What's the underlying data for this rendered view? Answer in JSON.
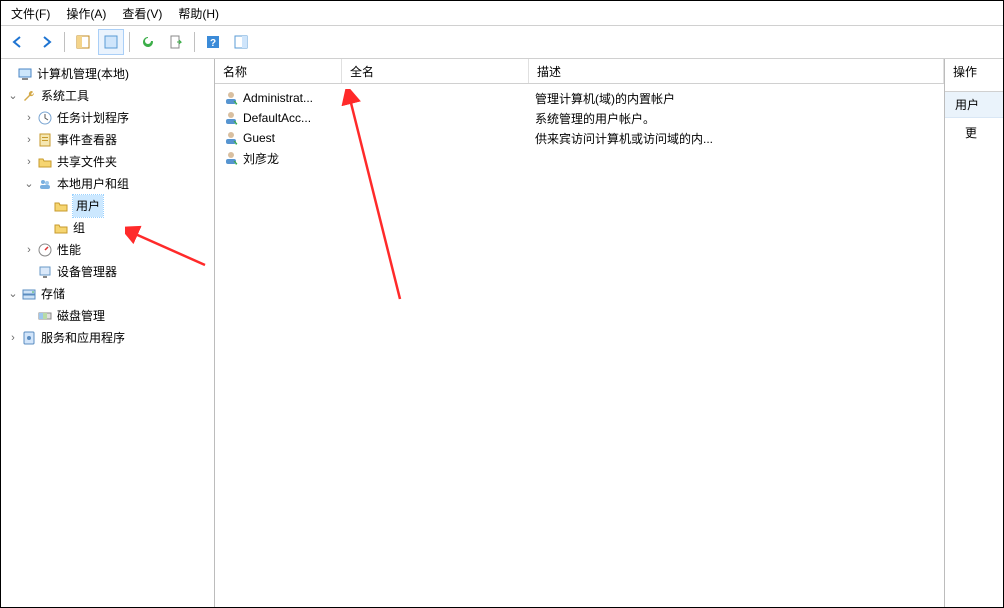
{
  "menu": {
    "file": "文件(F)",
    "action": "操作(A)",
    "view": "查看(V)",
    "help": "帮助(H)"
  },
  "tree": {
    "root": "计算机管理(本地)",
    "system_tools": "系统工具",
    "task_scheduler": "任务计划程序",
    "event_viewer": "事件查看器",
    "shared_folders": "共享文件夹",
    "local_users_groups": "本地用户和组",
    "users": "用户",
    "groups": "组",
    "performance": "性能",
    "device_manager": "设备管理器",
    "storage": "存储",
    "disk_management": "磁盘管理",
    "services_apps": "服务和应用程序"
  },
  "columns": {
    "name": "名称",
    "fullname": "全名",
    "description": "描述"
  },
  "users_list": [
    {
      "name": "Administrat...",
      "fullname": "",
      "description": "管理计算机(域)的内置帐户"
    },
    {
      "name": "DefaultAcc...",
      "fullname": "",
      "description": "系统管理的用户帐户。"
    },
    {
      "name": "Guest",
      "fullname": "",
      "description": "供来宾访问计算机或访问域的内..."
    },
    {
      "name": "刘彦龙",
      "fullname": "",
      "description": ""
    }
  ],
  "actions": {
    "header": "操作",
    "selected": "用户",
    "more": "更"
  }
}
